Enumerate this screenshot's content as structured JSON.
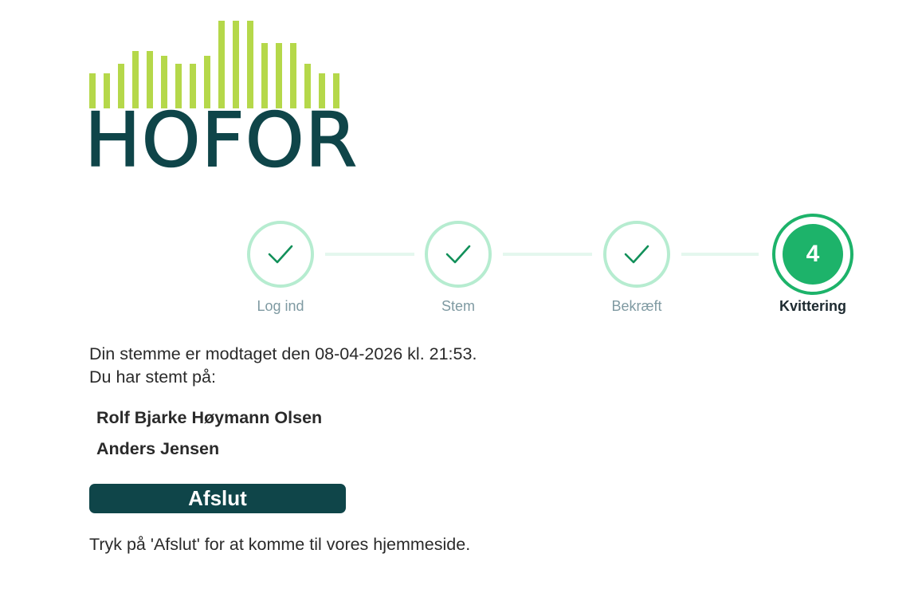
{
  "brand": {
    "name": "HOFOR",
    "primary_color": "#0f4549",
    "accent_color": "#b5d84a"
  },
  "stepper": {
    "steps": [
      {
        "label": "Log ind",
        "state": "done",
        "icon": "check-icon"
      },
      {
        "label": "Stem",
        "state": "done",
        "icon": "check-icon"
      },
      {
        "label": "Bekræft",
        "state": "done",
        "icon": "check-icon"
      },
      {
        "label": "Kvittering",
        "state": "active",
        "number": "4"
      }
    ],
    "done_color": "#b6ecd0",
    "active_color": "#1db36a"
  },
  "receipt": {
    "confirmation": "Din stemme er modtaget den 08-04-2026 kl. 21:53.",
    "voted_for_label": "Du har stemt på:",
    "candidates": [
      "Rolf Bjarke Høymann Olsen",
      "Anders Jensen"
    ]
  },
  "actions": {
    "finish_label": "Afslut",
    "hint": "Tryk på 'Afslut' for at komme til vores hjemmeside."
  }
}
